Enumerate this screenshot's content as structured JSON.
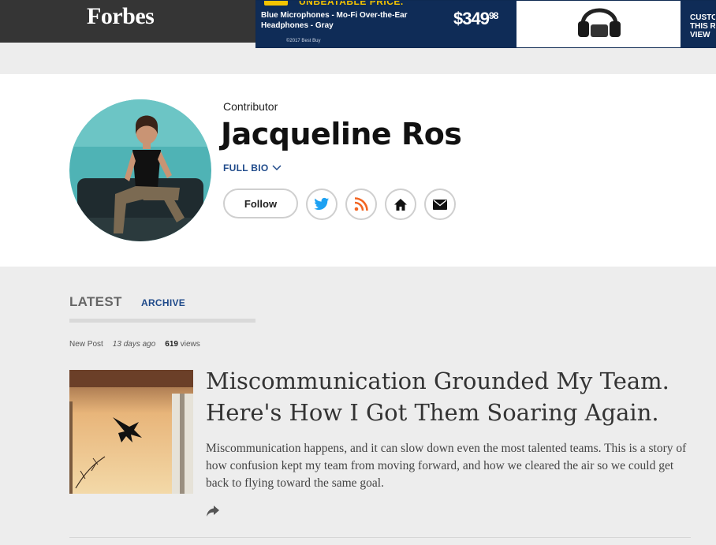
{
  "header": {
    "logo": "Forbes"
  },
  "ad": {
    "headline": "UNBEATABLE PRICE.",
    "product": "Blue Microphones - Mo-Fi Over-the-Ear Headphones - Gray",
    "price_dollars": "$349",
    "price_cents": "98",
    "copyright": "©2017 Best Buy",
    "right_text": "CUSTO THIS R VIEW"
  },
  "profile": {
    "role": "Contributor",
    "name": "Jacqueline Ros",
    "full_bio_label": "FULL BIO",
    "follow_label": "Follow",
    "social_icons": [
      "twitter-icon",
      "rss-icon",
      "home-icon",
      "email-icon"
    ]
  },
  "tabs": {
    "latest": "LATEST",
    "archive": "ARCHIVE"
  },
  "post": {
    "type": "New Post",
    "age": "13 days ago",
    "views_count": "619",
    "views_label": "views",
    "headline": "Miscommunication Grounded My Team. Here's How I Got Them Soaring Again.",
    "summary": "Miscommunication happens, and it can slow down even the most talented teams. This is a story of how confusion kept my team from moving forward, and how we cleared the air so we could get back to flying toward the same goal."
  },
  "colors": {
    "topbar": "#353535",
    "link_blue": "#1f4a8a",
    "twitter": "#1da1f2",
    "rss": "#f26522"
  }
}
